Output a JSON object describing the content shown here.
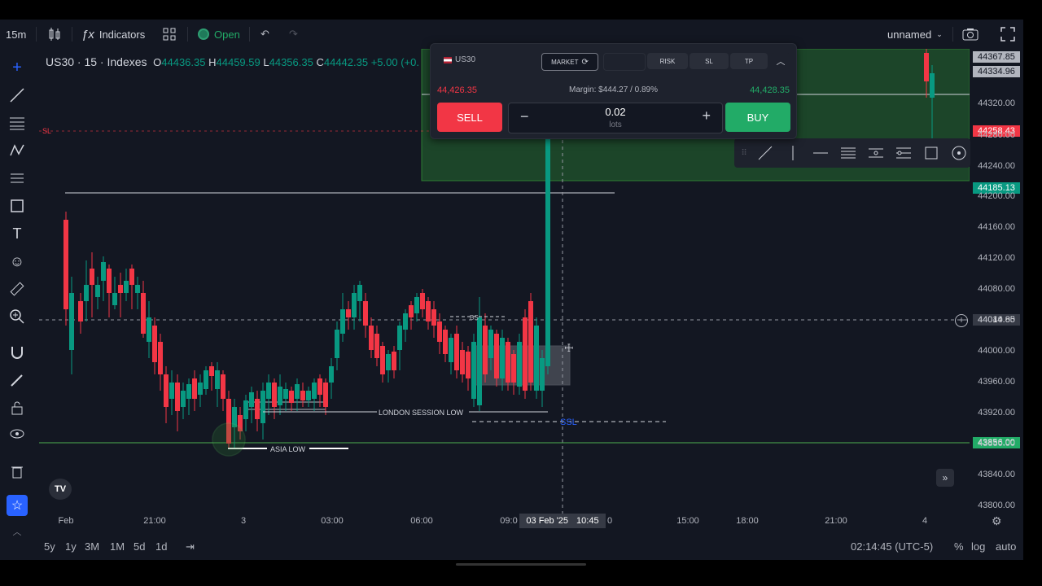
{
  "toolbar": {
    "interval": "15m",
    "indicators_label": "Indicators",
    "market_status": "Open",
    "layout_name": "unnamed"
  },
  "symbol": {
    "title": "US30 · 15 · Indexes",
    "o_label": "O",
    "o": "44436.35",
    "h_label": "H",
    "h": "44459.59",
    "l_label": "L",
    "l": "44356.35",
    "c_label": "C",
    "c": "44442.35",
    "change": "+5.00 (+0."
  },
  "trade_panel": {
    "symbol": "US30",
    "order_type": "MARKET",
    "risk_label": "RISK",
    "sl_label": "SL",
    "tp_label": "TP",
    "sell_price": "44,426.35",
    "buy_price": "44,428.35",
    "margin": "Margin: $444.27 / 0.89%",
    "sell_label": "SELL",
    "buy_label": "BUY",
    "quantity": "0.02",
    "quantity_unit": "lots"
  },
  "price_axis": {
    "ticks": [
      "44320.00",
      "44280.00",
      "44240.00",
      "44200.00",
      "44160.00",
      "44120.00",
      "44080.00",
      "44040.00",
      "44000.00",
      "43960.00",
      "43920.00",
      "43880.00",
      "43840.00",
      "43800.00"
    ],
    "labels": {
      "tp_price": "44367.85",
      "current_price": "44334.96",
      "sl_price": "44258.43",
      "line_price": "44185.13",
      "crosshair_price": "44014.85",
      "asia_low_price": "43856.00"
    }
  },
  "time_axis": {
    "ticks": [
      "Feb",
      "21:00",
      "3",
      "03:00",
      "06:00",
      "09:0",
      "0",
      "15:00",
      "18:00",
      "21:00",
      "4"
    ],
    "crosshair_date": "03 Feb '25",
    "crosshair_time": "10:45"
  },
  "annotations": {
    "sl_tag": "SL",
    "london_low": "LONDON SESSION LOW",
    "asia_low": "ASIA LOW",
    "ssl": "SSL",
    "bsl": "BS"
  },
  "bottom_bar": {
    "ranges": [
      "5y",
      "1y",
      "3M",
      "1M",
      "5d",
      "1d"
    ],
    "clock": "02:14:45 (UTC-5)",
    "percent": "%",
    "log": "log",
    "auto": "auto"
  },
  "colors": {
    "up": "#089981",
    "down": "#f23645",
    "background": "#131722",
    "accent": "#2962ff"
  }
}
